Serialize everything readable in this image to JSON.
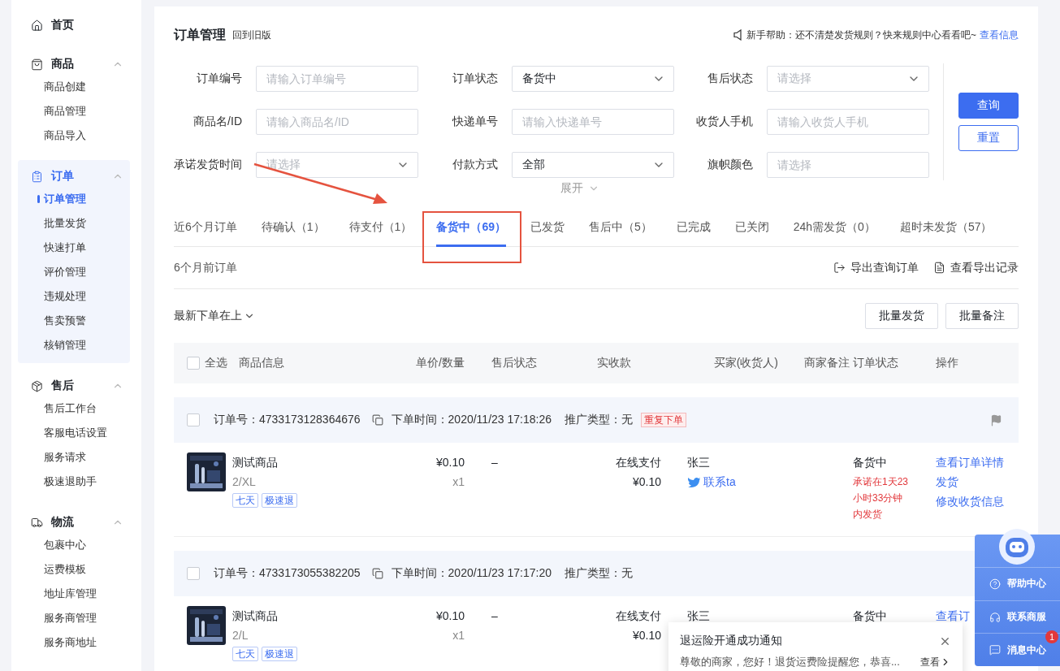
{
  "sidebar": [
    {
      "kind": "link",
      "label": "首页"
    },
    {
      "kind": "group",
      "label": "商品",
      "expanded": true,
      "selected": false,
      "items": [
        {
          "label": "商品创建",
          "selected": false
        },
        {
          "label": "商品管理",
          "selected": false
        },
        {
          "label": "商品导入",
          "selected": false
        }
      ]
    },
    {
      "kind": "group",
      "label": "订单",
      "expanded": true,
      "selected": true,
      "items": [
        {
          "label": "订单管理",
          "selected": true
        },
        {
          "label": "批量发货",
          "selected": false
        },
        {
          "label": "快速打单",
          "selected": false
        },
        {
          "label": "评价管理",
          "selected": false
        },
        {
          "label": "违规处理",
          "selected": false
        },
        {
          "label": "售卖预警",
          "selected": false
        },
        {
          "label": "核销管理",
          "selected": false
        }
      ]
    },
    {
      "kind": "group",
      "label": "售后",
      "expanded": true,
      "selected": false,
      "items": [
        {
          "label": "售后工作台",
          "selected": false
        },
        {
          "label": "客服电话设置",
          "selected": false
        },
        {
          "label": "服务请求",
          "selected": false
        },
        {
          "label": "极速退助手",
          "selected": false
        }
      ]
    },
    {
      "kind": "group",
      "label": "物流",
      "expanded": true,
      "selected": false,
      "items": [
        {
          "label": "包裹中心",
          "selected": false
        },
        {
          "label": "运费模板",
          "selected": false
        },
        {
          "label": "地址库管理",
          "selected": false
        },
        {
          "label": "服务商管理",
          "selected": false
        },
        {
          "label": "服务商地址",
          "selected": false
        }
      ]
    }
  ],
  "header": {
    "title": "订单管理",
    "link": "回到旧版",
    "notice": "新手帮助：还不清楚发货规则？快来规则中心看看吧~",
    "notice_link": "查看信息"
  },
  "filters": [
    {
      "label": "订单编号",
      "kind": "text",
      "placeholder": "请输入订单编号"
    },
    {
      "label": "订单状态",
      "kind": "select",
      "value": "备货中"
    },
    {
      "label": "售后状态",
      "kind": "select",
      "placeholder": "请选择"
    },
    {
      "label": "商品名/ID",
      "kind": "text",
      "placeholder": "请输入商品名/ID"
    },
    {
      "label": "快递单号",
      "kind": "text",
      "placeholder": "请输入快递单号"
    },
    {
      "label": "收货人手机",
      "kind": "text",
      "placeholder": "请输入收货人手机"
    },
    {
      "label": "承诺发货时间",
      "kind": "select",
      "placeholder": "请选择"
    },
    {
      "label": "付款方式",
      "kind": "select",
      "value": "全部"
    },
    {
      "label": "旗帜颜色",
      "kind": "text",
      "placeholder": "请选择"
    }
  ],
  "filter_buttons": {
    "query": "查询",
    "reset": "重置"
  },
  "expand": "展开",
  "tabs": [
    {
      "label": "近6个月订单",
      "selected": false
    },
    {
      "label": "待确认（1）",
      "selected": false
    },
    {
      "label": "待支付（1）",
      "selected": false
    },
    {
      "label": "备货中（69）",
      "selected": true
    },
    {
      "label": "已发货",
      "selected": false
    },
    {
      "label": "售后中（5）",
      "selected": false
    },
    {
      "label": "已完成",
      "selected": false
    },
    {
      "label": "已关闭",
      "selected": false
    },
    {
      "label": "24h需发货（0）",
      "selected": false
    },
    {
      "label": "超时未发货（57）",
      "selected": false
    }
  ],
  "history_label": "6个月前订单",
  "export_actions": [
    "导出查询订单",
    "查看导出记录"
  ],
  "sort": "最新下单在上",
  "bulk_actions": [
    "批量发货",
    "批量备注"
  ],
  "table": {
    "select_all": "全选",
    "select_all_checked": false,
    "columns": [
      "商品信息",
      "单价/数量",
      "售后状态",
      "实收款",
      "买家(收货人)",
      "商家备注",
      "订单状态",
      "操作"
    ],
    "orders": [
      {
        "checked": false,
        "order_no": "订单号：4733173128364676",
        "order_time": "下单时间：2020/11/23 17:18:26",
        "promo": "推广类型：无",
        "tag": "重复下单",
        "flag": true,
        "product": {
          "name": "测试商品",
          "spec": "2/XL",
          "tags": [
            "七天",
            "极速退"
          ]
        },
        "price": "¥0.10",
        "qty": "x1",
        "aftersale": "–",
        "payment": "在线支付",
        "paid": "¥0.10",
        "buyer": "张三",
        "contact": "联系ta",
        "status": "备货中",
        "deadline": "承诺在1天23小时33分钟内发货",
        "actions": [
          "查看订单详情",
          "发货",
          "修改收货信息"
        ]
      },
      {
        "checked": false,
        "order_no": "订单号：4733173055382205",
        "order_time": "下单时间：2020/11/23 17:17:20",
        "promo": "推广类型：无",
        "flag": false,
        "product": {
          "name": "测试商品",
          "spec": "2/L",
          "tags": [
            "七天",
            "极速退"
          ]
        },
        "price": "¥0.10",
        "qty": "x1",
        "aftersale": "–",
        "payment": "在线支付",
        "paid": "¥0.10",
        "buyer": "张三",
        "status": "备货中",
        "actions": [
          "查看订"
        ]
      }
    ]
  },
  "help_panel": {
    "items": [
      {
        "label": "帮助中心"
      },
      {
        "label": "联系商服"
      },
      {
        "label": "消息中心",
        "badge": "1"
      }
    ]
  },
  "notification": {
    "title": "退运险开通成功通知",
    "body": "尊敬的商家，您好！退货运费险提醒您，恭喜...",
    "link": "查看"
  }
}
